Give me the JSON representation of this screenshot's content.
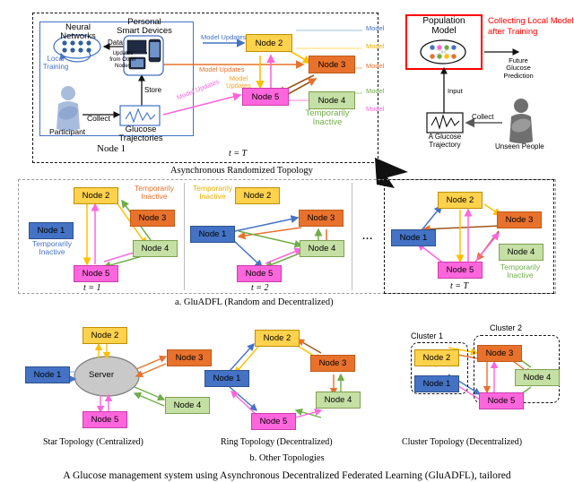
{
  "figure": {
    "caption": "A Glucose management system using Asynchronous Decentralized Federated Learning (GluADFL), tailored",
    "section_a_label": "a. GluADFL (Random and Decentralized)",
    "section_b_label": "b. Other Topologies",
    "top_panel_label": "Asynchronous Randomized Topology"
  },
  "nodes": {
    "n1": "Node 1",
    "n2": "Node 2",
    "n3": "Node 3",
    "n4": "Node 4",
    "n5": "Node 5",
    "server": "Server"
  },
  "colors": {
    "node1": "#4472C4",
    "node2": "#FFD24D",
    "node3": "#E8722C",
    "node4": "#C5E0A5",
    "node5": "#FF66DD",
    "server": "#C9C9C9",
    "highlight_red": "#FF0000",
    "inactive_green": "#70AD47"
  },
  "top_panel": {
    "node1_detail": {
      "box_label": "Node 1",
      "neural_networks": "Neural\nNetworks",
      "neural_networks_l1": "Neural",
      "neural_networks_l2": "Networks",
      "local_training_l1": "Local",
      "local_training_l2": "Training",
      "participant": "Participant",
      "collect": "Collect",
      "store": "Store",
      "data": "Data",
      "updates_from_other_nodes": "Updates\nfrom Other\nNodes",
      "updates_l1": "Updates",
      "updates_l2": "from Other",
      "updates_l3": "Nodes",
      "glucose_trajectories_l1": "Glucose",
      "glucose_trajectories_l2": "Trajectories",
      "personal_smart_devices_l1": "Personal",
      "personal_smart_devices_l2": "Smart Devices",
      "device_laptop": "Laptop",
      "device_phone": "Smart Phone",
      "device_pad": "Pad"
    },
    "model_update_labels": [
      {
        "text": "Model Updates",
        "color": "#4472C4"
      },
      {
        "text": "Model Updates",
        "color": "#E8722C"
      },
      {
        "text": "Model\nUpdates",
        "color": "#FFA21E"
      },
      {
        "text": "Model Updates",
        "color": "#FF66DD"
      }
    ],
    "model_update_1": "Model Updates",
    "model_update_2": "Model Updates",
    "model_update_3_l1": "Model",
    "model_update_3_l2": "Updates",
    "model_update_4": "Model Updates",
    "model_column_labels": [
      "Model",
      "Model",
      "Model",
      "Model",
      "Model"
    ],
    "temporarily_inactive_l1": "Temporarily",
    "temporarily_inactive_l2": "Inactive",
    "time_label": "t = T",
    "population": {
      "title_l1": "Population",
      "title_l2": "Model",
      "banner_l1": "Collecting Local Models",
      "banner_l2": "after Training",
      "future_prediction_l1": "Future",
      "future_prediction_l2": "Glucose",
      "future_prediction_l3": "Prediction",
      "input": "Input",
      "collect": "Collect",
      "glucose_trajectory_l1": "A Glucose",
      "glucose_trajectory_l2": "Trajectory",
      "unseen_people": "Unseen People"
    }
  },
  "middle_panels": [
    {
      "time_label": "t = 1",
      "inactive_node": "Node 1",
      "inactive_l1": "Temporarily",
      "inactive_l2": "Inactive",
      "inactive_color": "#4472C4"
    },
    {
      "time_label": "t = 2",
      "inactive_node": "Node 2",
      "inactive_l1": "Temporarily",
      "inactive_l2": "Inactive",
      "inactive_color": "#E8B000"
    },
    {
      "time_label": "t = T",
      "inactive_node": "Node 4",
      "inactive_l1": "Temporarily",
      "inactive_l2": "Inactive",
      "inactive_color": "#70AD47"
    }
  ],
  "ellipsis": "...",
  "bottom_panels": [
    {
      "title": "Star Topology (Centralized)"
    },
    {
      "title": "Ring Topology (Decentralized)"
    },
    {
      "title": "Cluster Topology (Decentralized)",
      "cluster1": "Cluster 1",
      "cluster2": "Cluster 2"
    }
  ]
}
